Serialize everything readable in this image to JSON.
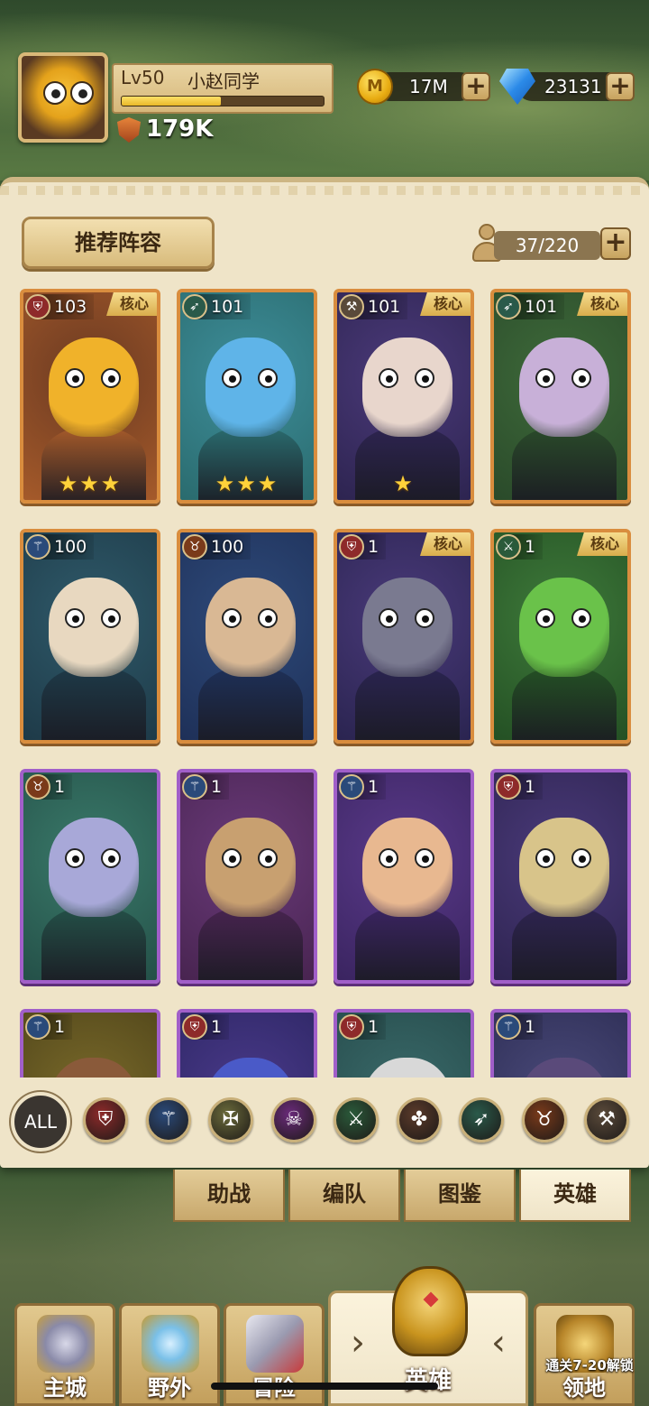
{
  "player": {
    "level": "Lv50",
    "name": "小赵同学",
    "xp_fraction": 0.49,
    "power": "179K"
  },
  "resources": {
    "coin_symbol": "M",
    "coins": "17M",
    "gems": "23131",
    "plus": "+"
  },
  "panel": {
    "recommend_label": "推荐阵容",
    "capacity": "37/220",
    "plus": "+"
  },
  "heroes": [
    {
      "level": "103",
      "core": "核心",
      "stars": "★★★",
      "class_icon": "shield-icon",
      "rarity": "legendary",
      "bg": [
        "#6b3a22",
        "#a55a2a"
      ],
      "skin": "#f0b22a"
    },
    {
      "level": "101",
      "core": "",
      "stars": "★★★",
      "class_icon": "bow-icon",
      "rarity": "legendary",
      "bg": [
        "#3e8e9a",
        "#2a6b6e"
      ],
      "skin": "#5fb4e8"
    },
    {
      "level": "101",
      "core": "核心",
      "stars": "★",
      "class_icon": "axe-icon",
      "rarity": "legendary",
      "bg": [
        "#4b3a7a",
        "#2d2450"
      ],
      "skin": "#e8d6cc"
    },
    {
      "level": "101",
      "core": "核心",
      "stars": "",
      "class_icon": "bow-icon",
      "rarity": "legendary",
      "bg": [
        "#3e6a3a",
        "#2a4a2a"
      ],
      "skin": "#c8b0d8"
    },
    {
      "level": "100",
      "core": "",
      "stars": "",
      "class_icon": "staff-icon",
      "rarity": "legendary",
      "bg": [
        "#2f5a6a",
        "#1e3a48"
      ],
      "skin": "#e8d8c0"
    },
    {
      "level": "100",
      "core": "",
      "stars": "",
      "class_icon": "beast-icon",
      "rarity": "legendary",
      "bg": [
        "#2e4a7a",
        "#1e3058"
      ],
      "skin": "#d9b894"
    },
    {
      "level": "1",
      "core": "核心",
      "stars": "",
      "class_icon": "shield-icon",
      "rarity": "legendary",
      "bg": [
        "#4a3a7a",
        "#2a2450"
      ],
      "skin": "#7a7a90"
    },
    {
      "level": "1",
      "core": "核心",
      "stars": "",
      "class_icon": "sword-icon",
      "rarity": "legendary",
      "bg": [
        "#3e7a3a",
        "#245024"
      ],
      "skin": "#6ac24a"
    },
    {
      "level": "1",
      "core": "",
      "stars": "",
      "class_icon": "beast-icon",
      "rarity": "epic",
      "bg": [
        "#3a7a6a",
        "#245048"
      ],
      "skin": "#a8a8d8"
    },
    {
      "level": "1",
      "core": "",
      "stars": "",
      "class_icon": "staff-icon",
      "rarity": "epic",
      "bg": [
        "#6a3a7a",
        "#482450"
      ],
      "skin": "#c8a070"
    },
    {
      "level": "1",
      "core": "",
      "stars": "",
      "class_icon": "staff-icon",
      "rarity": "epic",
      "bg": [
        "#5a3a8a",
        "#3a2460"
      ],
      "skin": "#e8b890"
    },
    {
      "level": "1",
      "core": "",
      "stars": "",
      "class_icon": "shield-icon",
      "rarity": "epic",
      "bg": [
        "#4a3a7a",
        "#2e2450"
      ],
      "skin": "#d8c48a"
    },
    {
      "level": "1",
      "core": "",
      "stars": "",
      "class_icon": "staff-icon",
      "rarity": "epic",
      "bg": [
        "#7a6a2a",
        "#4a4018"
      ],
      "skin": "#8a5a3a"
    },
    {
      "level": "1",
      "core": "",
      "stars": "",
      "class_icon": "shield-icon",
      "rarity": "epic",
      "bg": [
        "#4a3a8a",
        "#2a2460"
      ],
      "skin": "#4a5ac8"
    },
    {
      "level": "1",
      "core": "",
      "stars": "",
      "class_icon": "shield-icon",
      "rarity": "epic",
      "bg": [
        "#3a6a6a",
        "#244848"
      ],
      "skin": "#d8d8d8"
    },
    {
      "level": "1",
      "core": "",
      "stars": "",
      "class_icon": "staff-icon",
      "rarity": "epic",
      "bg": [
        "#4a4a7a",
        "#2a2a50"
      ],
      "skin": "#5a4a7a"
    }
  ],
  "filters": {
    "all_label": "ALL",
    "icons": [
      {
        "name": "shield-filter-icon",
        "glyph": "⛨",
        "color": "#8e2a2a"
      },
      {
        "name": "staff-filter-icon",
        "glyph": "⚚",
        "color": "#2a4a7a"
      },
      {
        "name": "holy-filter-icon",
        "glyph": "✠",
        "color": "#6a6a3a"
      },
      {
        "name": "skull-filter-icon",
        "glyph": "☠",
        "color": "#6a2a7a"
      },
      {
        "name": "blades-filter-icon",
        "glyph": "⚔",
        "color": "#2a5a3a"
      },
      {
        "name": "paw-filter-icon",
        "glyph": "✤",
        "color": "#5a3a2a"
      },
      {
        "name": "bow-filter-icon",
        "glyph": "➶",
        "color": "#2a5a4a"
      },
      {
        "name": "beast-filter-icon",
        "glyph": "♉",
        "color": "#7a3a1a"
      },
      {
        "name": "hammer-filter-icon",
        "glyph": "⚒",
        "color": "#5a4a3a"
      }
    ]
  },
  "subtabs": [
    "助战",
    "编队",
    "图鉴",
    "英雄"
  ],
  "nav": {
    "main_city": "主城",
    "wild": "野外",
    "adventure": "冒险",
    "heroes": "英雄",
    "territory": "领地",
    "territory_note": "通关7-20解锁"
  }
}
